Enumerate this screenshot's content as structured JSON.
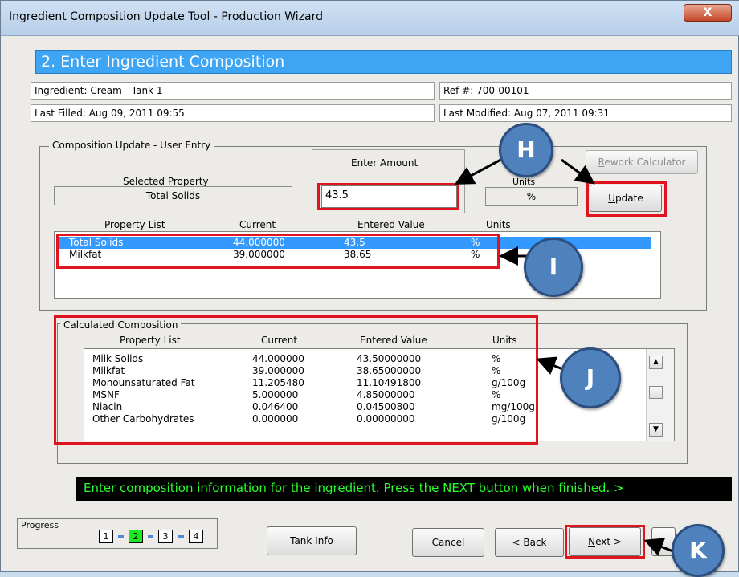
{
  "window": {
    "title": "Ingredient Composition Update Tool - Production Wizard",
    "close_label": "X"
  },
  "step": {
    "title": "2. Enter Ingredient Composition"
  },
  "info": {
    "ingredient": "Ingredient:  Cream - Tank 1",
    "ref": "Ref #: 700-00101",
    "last_filled": "Last Filled: Aug 09, 2011 09:55",
    "last_modified": "Last Modified: Aug 07, 2011 09:31"
  },
  "entry": {
    "group_title": "Composition Update - User Entry",
    "selected_property_label": "Selected Property",
    "selected_property": "Total Solids",
    "enter_amount_label": "Enter Amount",
    "amount_value": "43.5",
    "units_label": "Units",
    "units_value": "%",
    "rework_button": "Rework Calculator",
    "update_button": "Update",
    "columns": [
      "Property List",
      "Current",
      "Entered Value",
      "Units"
    ],
    "rows": [
      {
        "name": "Total Solids",
        "current": "44.000000",
        "entered": "43.5",
        "units": "%"
      },
      {
        "name": "Milkfat",
        "current": "39.000000",
        "entered": "38.65",
        "units": "%"
      }
    ]
  },
  "calculated": {
    "group_title": "Calculated Composition",
    "columns": [
      "Property List",
      "Current",
      "Entered Value",
      "Units"
    ],
    "rows": [
      {
        "name": "Milk Solids",
        "current": "44.000000",
        "entered": "43.50000000",
        "units": "%"
      },
      {
        "name": "Milkfat",
        "current": "39.000000",
        "entered": "38.65000000",
        "units": "%"
      },
      {
        "name": "Monounsaturated Fat",
        "current": "11.205480",
        "entered": "11.10491800",
        "units": "g/100g"
      },
      {
        "name": "MSNF",
        "current": "5.000000",
        "entered": "4.85000000",
        "units": "%"
      },
      {
        "name": "Niacin",
        "current": "0.046400",
        "entered": "0.04500800",
        "units": "mg/100g"
      },
      {
        "name": "Other Carbohydrates",
        "current": "0.000000",
        "entered": "0.00000000",
        "units": "g/100g"
      }
    ]
  },
  "status": {
    "text": "Enter composition information for the ingredient.  Press the NEXT button when finished. >"
  },
  "progress": {
    "label": "Progress",
    "steps": [
      "1",
      "2",
      "3",
      "4"
    ],
    "current": 2
  },
  "buttons": {
    "tank_info": "Tank Info",
    "cancel": "Cancel",
    "back": "< Back",
    "next": "Next >"
  },
  "callouts": {
    "h": "H",
    "i": "I",
    "j": "J",
    "k": "K"
  },
  "colors": {
    "step_bar": "#3da5f4",
    "selection": "#3399ff",
    "status_text": "#2bff2b",
    "highlight": "#e0141e",
    "callout": "#4f81bd",
    "progress_current": "#1fe81f"
  }
}
